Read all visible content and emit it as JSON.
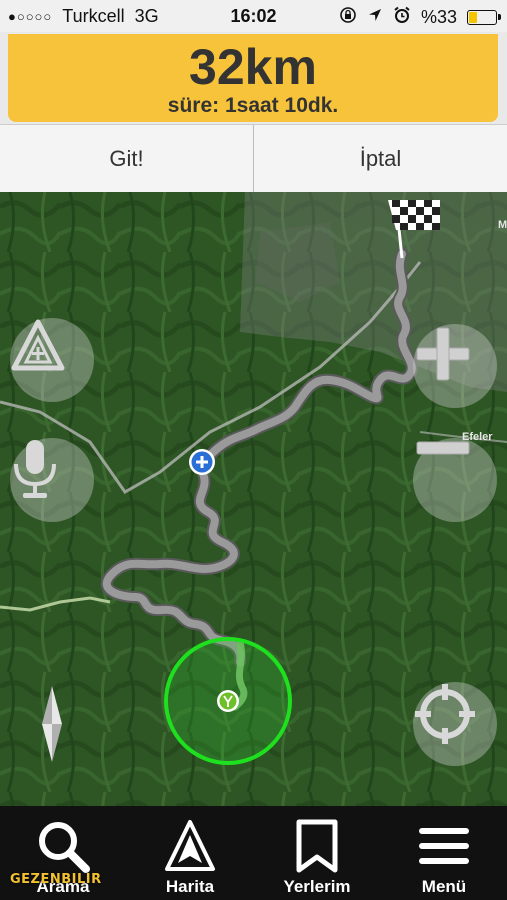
{
  "status_bar": {
    "signal": "●○○○○",
    "carrier": "Turkcell",
    "network": "3G",
    "time": "16:02",
    "battery": "%33",
    "battery_level": 0.33
  },
  "route": {
    "distance": "32km",
    "duration": "süre: 1saat 10dk."
  },
  "actions": {
    "go": "Git!",
    "cancel": "İptal"
  },
  "map": {
    "place_label": "Efeler",
    "place_label_partial": "M"
  },
  "tabs": [
    {
      "label": "Arama",
      "icon": "search-icon"
    },
    {
      "label": "Harita",
      "icon": "navigation-arrow-icon"
    },
    {
      "label": "Yerlerim",
      "icon": "bookmark-icon"
    },
    {
      "label": "Menü",
      "icon": "hamburger-menu-icon"
    }
  ],
  "watermark": "GEZENBILIR",
  "colors": {
    "banner": "#f7c33a",
    "route": "#9a9a9a",
    "location_ring": "#1fe01f",
    "map": "#2f5a26",
    "tabbar": "#111111"
  }
}
